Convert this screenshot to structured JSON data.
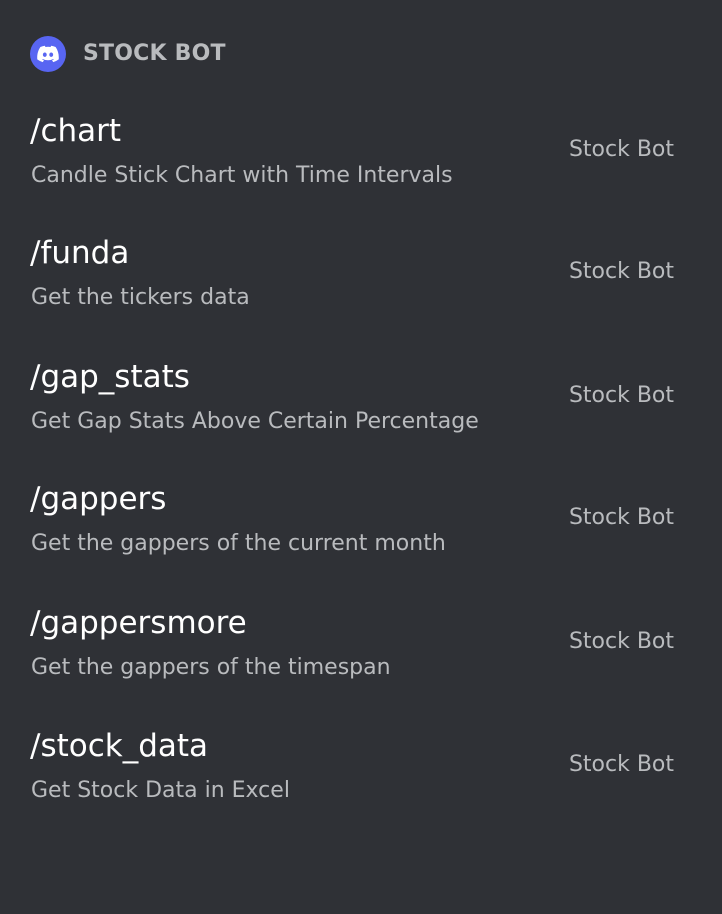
{
  "header": {
    "icon": "discord-icon",
    "accent_color": "#5865f2",
    "bot_name": "STOCK BOT"
  },
  "commands": [
    {
      "name": "/chart",
      "description": "Candle Stick Chart with Time Intervals",
      "source": "Stock Bot"
    },
    {
      "name": "/funda",
      "description": "Get the tickers data",
      "source": "Stock Bot"
    },
    {
      "name": "/gap_stats",
      "description": "Get Gap Stats Above Certain Percentage",
      "source": "Stock Bot"
    },
    {
      "name": "/gappers",
      "description": "Get the gappers of the current month",
      "source": "Stock Bot"
    },
    {
      "name": "/gappersmore",
      "description": "Get the gappers of the timespan",
      "source": "Stock Bot"
    },
    {
      "name": "/stock_data",
      "description": "Get Stock Data in Excel",
      "source": "Stock Bot"
    }
  ],
  "colors": {
    "background": "#2f3136",
    "command_text": "#ffffff",
    "muted_text": "#b9bbbe"
  }
}
